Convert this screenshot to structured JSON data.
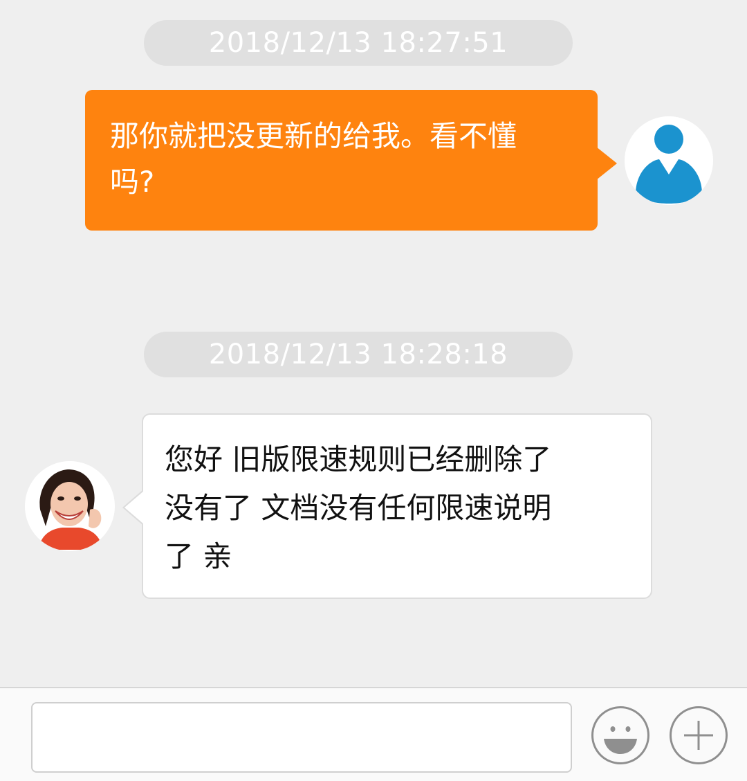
{
  "messages": [
    {
      "timestamp": "2018/12/13 18:27:51",
      "sender": "user",
      "lines": [
        "那你就把没更新的给我。看不懂",
        "吗?"
      ]
    },
    {
      "timestamp": "2018/12/13 18:28:18",
      "sender": "agent",
      "lines": [
        "您好  旧版限速规则已经删除了",
        "没有了  文档没有任何限速说明",
        "了 亲"
      ]
    }
  ],
  "input_bar": {
    "placeholder": "",
    "emoji_icon": "smiley-icon",
    "plus_icon": "plus-icon"
  },
  "colors": {
    "outgoing_bubble": "#fe830f",
    "user_avatar": "#1b93cf",
    "background": "#efefef"
  }
}
